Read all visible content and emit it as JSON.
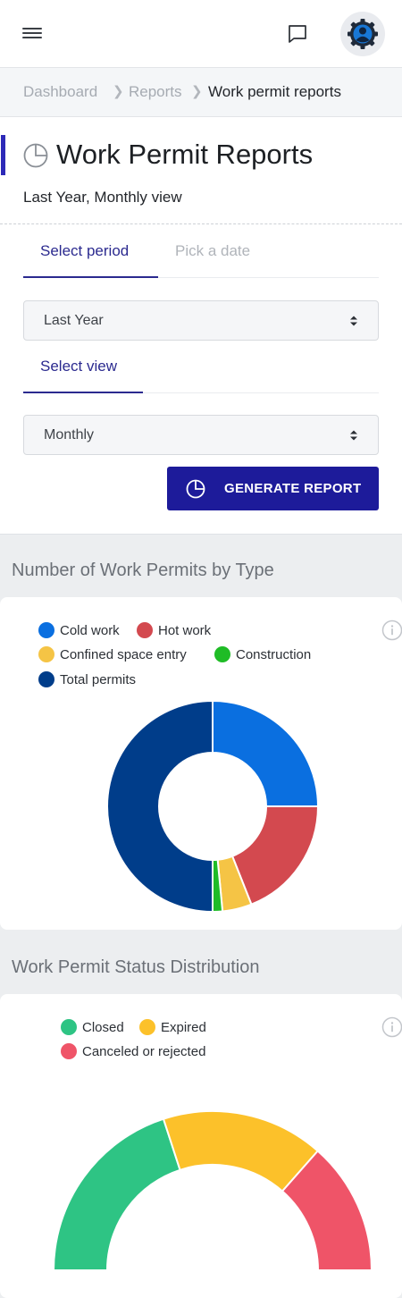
{
  "header": {
    "menu_icon": "hamburger-menu-icon",
    "messages_icon": "chat-bubble-icon",
    "avatar_icon": "user-gear-avatar-icon"
  },
  "breadcrumb": {
    "items": [
      "Dashboard",
      "Reports",
      "Work permit reports"
    ]
  },
  "report": {
    "title": "Work Permit Reports",
    "title_icon": "pie-chart-icon",
    "subtitle": "Last Year, Monthly view"
  },
  "period_tabs": {
    "select_period": "Select period",
    "pick_date": "Pick a date"
  },
  "period_select": {
    "value": "Last Year"
  },
  "view_tab": {
    "label": "Select view"
  },
  "view_select": {
    "value": "Monthly"
  },
  "generate_button": {
    "label": "GENERATE REPORT",
    "icon": "pie-chart-icon"
  },
  "colors": {
    "accent": "#1d1b9a",
    "cold_work": "#0a6fe0",
    "hot_work": "#d3494f",
    "confined_space": "#f5c445",
    "construction": "#1fbc26",
    "total_permits": "#003d8a",
    "closed": "#2ec484",
    "expired": "#fcc12a",
    "canceled": "#ef5468"
  },
  "charts": {
    "by_type": {
      "title": "Number of Work Permits by Type",
      "info_icon": "info-circle-icon"
    },
    "status": {
      "title": "Work Permit Status Distribution",
      "info_icon": "info-circle-icon"
    }
  },
  "chart_data": [
    {
      "type": "pie",
      "variant": "doughnut",
      "title": "Number of Work Permits by Type",
      "legend_position": "top-left",
      "labels": [
        "Cold work",
        "Hot work",
        "Confined space entry",
        "Construction",
        "Total permits"
      ],
      "values": [
        25,
        19,
        4.5,
        1.5,
        50
      ]
    },
    {
      "type": "pie",
      "variant": "half-doughnut",
      "title": "Work Permit Status Distribution",
      "legend_position": "top-left",
      "labels": [
        "Closed",
        "Expired",
        "Canceled or rejected"
      ],
      "values": [
        40,
        33,
        27
      ]
    }
  ]
}
